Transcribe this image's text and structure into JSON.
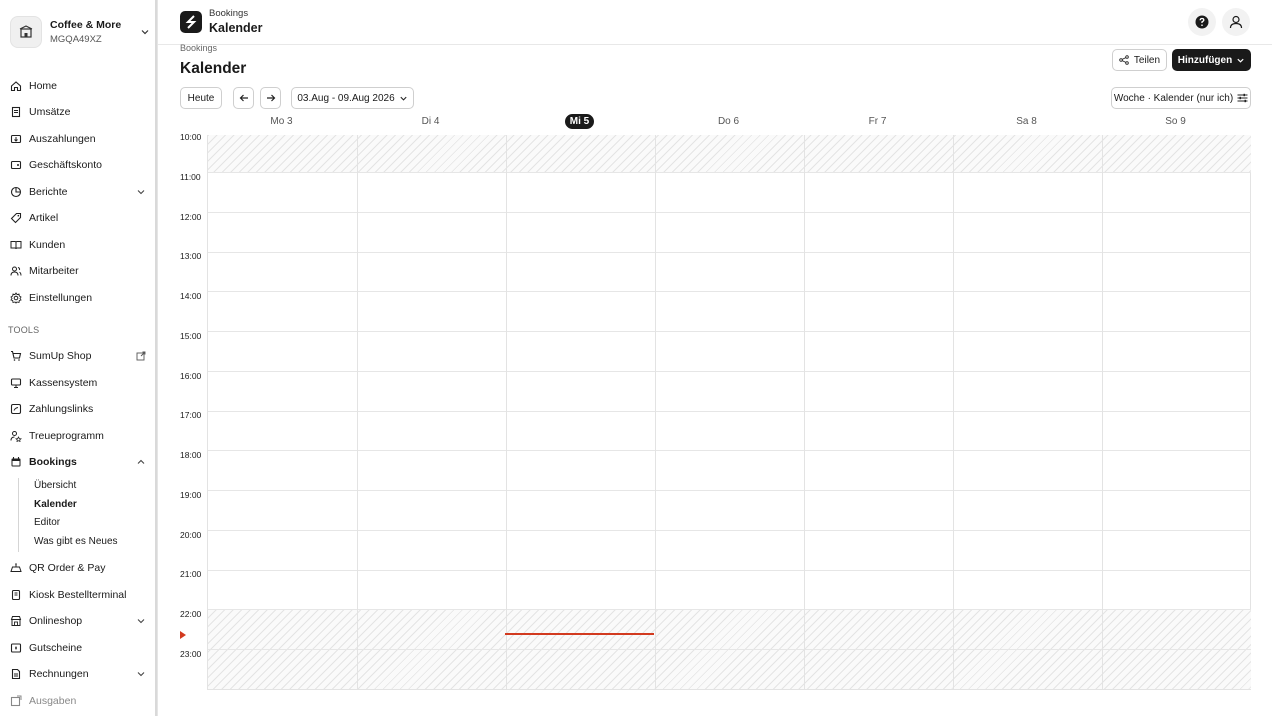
{
  "account": {
    "name": "Coffee & More",
    "id": "MGQA49XZ"
  },
  "nav": {
    "items": [
      {
        "label": "Home",
        "icon": "home-icon"
      },
      {
        "label": "Umsätze",
        "icon": "receipt-icon"
      },
      {
        "label": "Auszahlungen",
        "icon": "payout-icon"
      },
      {
        "label": "Geschäftskonto",
        "icon": "account-icon"
      },
      {
        "label": "Berichte",
        "icon": "chart-icon"
      },
      {
        "label": "Artikel",
        "icon": "tag-icon"
      },
      {
        "label": "Kunden",
        "icon": "book-icon"
      },
      {
        "label": "Mitarbeiter",
        "icon": "users-icon"
      },
      {
        "label": "Einstellungen",
        "icon": "gear-icon"
      }
    ],
    "tools_label": "TOOLS",
    "tools": [
      {
        "label": "SumUp Shop",
        "icon": "cart-icon"
      },
      {
        "label": "Kassensystem",
        "icon": "pos-icon"
      },
      {
        "label": "Zahlungslinks",
        "icon": "link-icon"
      },
      {
        "label": "Treueprogramm",
        "icon": "loyalty-icon"
      },
      {
        "label": "Bookings",
        "icon": "calendar-icon"
      },
      {
        "label": "QR Order & Pay",
        "icon": "qr-icon"
      },
      {
        "label": "Kiosk Bestellterminal",
        "icon": "kiosk-icon"
      },
      {
        "label": "Onlineshop",
        "icon": "store-icon"
      },
      {
        "label": "Gutscheine",
        "icon": "voucher-icon"
      },
      {
        "label": "Rechnungen",
        "icon": "invoice-icon"
      },
      {
        "label": "Ausgaben",
        "icon": "expense-icon"
      }
    ],
    "bookings_sub": [
      "Übersicht",
      "Kalender",
      "Editor",
      "Was gibt es Neues"
    ]
  },
  "topbar": {
    "section": "Bookings",
    "title": "Kalender"
  },
  "page": {
    "breadcrumb": "Bookings",
    "title": "Kalender",
    "share_label": "Teilen",
    "add_label": "Hinzufügen",
    "today_label": "Heute",
    "date_range": "03.Aug - 09.Aug 2026",
    "view_label": "Woche · Kalender (nur ich)"
  },
  "calendar": {
    "days": [
      "Mo 3",
      "Di 4",
      "Mi 5",
      "Do 6",
      "Fr 7",
      "Sa 8",
      "So 9"
    ],
    "today_index": 2,
    "hours": [
      "10:00",
      "11:00",
      "12:00",
      "13:00",
      "14:00",
      "15:00",
      "16:00",
      "17:00",
      "18:00",
      "19:00",
      "20:00",
      "21:00",
      "22:00",
      "23:00"
    ]
  },
  "colors": {
    "accent": "#1a1a1a",
    "now_line": "#d23a1f"
  }
}
